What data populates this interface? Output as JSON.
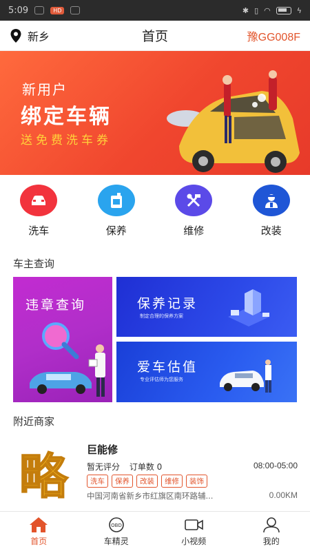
{
  "status_bar": {
    "time": "5:09",
    "badge": "HD"
  },
  "header": {
    "location": "新乡",
    "title": "首页",
    "plate": "豫GG008F"
  },
  "banner": {
    "line1": "新用户",
    "line2": "绑定车辆",
    "line3": "送免费洗车券",
    "page_count": 3,
    "active_page": 1
  },
  "services": [
    {
      "label": "洗车",
      "icon": "car-wash-icon",
      "color": "#f2333d"
    },
    {
      "label": "保养",
      "icon": "oil-can-icon",
      "color": "#2aa4ee"
    },
    {
      "label": "维修",
      "icon": "wrench-hammer-icon",
      "color": "#5b4ae8"
    },
    {
      "label": "改装",
      "icon": "mechanic-icon",
      "color": "#1f56d6"
    }
  ],
  "owner_query": {
    "title": "车主查询",
    "violation": {
      "title": "违章查询"
    },
    "record": {
      "title": "保养记录",
      "subtitle": "制定合理的保养方案"
    },
    "valuation": {
      "title": "爱车估值",
      "subtitle": "专业评估师为您服务"
    }
  },
  "nearby": {
    "title": "附近商家",
    "merchant": {
      "logo_text": "略",
      "name": "巨能修",
      "rating": "暂无评分",
      "orders": "订单数 0",
      "hours": "08:00-05:00",
      "tags": [
        "洗车",
        "保养",
        "改装",
        "维修",
        "装饰"
      ],
      "address": "中国河南省新乡市红旗区南环路辅...",
      "distance": "0.00KM"
    }
  },
  "tabbar": [
    {
      "label": "首页",
      "icon": "home-icon",
      "active": true
    },
    {
      "label": "车精灵",
      "icon": "obd-icon",
      "active": false
    },
    {
      "label": "小视频",
      "icon": "video-icon",
      "active": false
    },
    {
      "label": "我的",
      "icon": "profile-icon",
      "active": false
    }
  ],
  "colors": {
    "accent": "#e2542b",
    "banner_red": "#f0462e",
    "banner_yellow": "#ffd23a"
  }
}
